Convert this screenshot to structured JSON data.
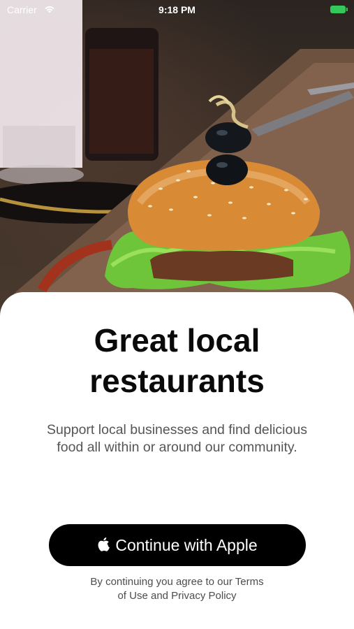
{
  "status_bar": {
    "carrier": "Carrier",
    "time": "9:18 PM",
    "battery_color": "#34c759"
  },
  "hero": {
    "image": "burger-photo",
    "description_icon": "burger-image"
  },
  "onboarding": {
    "title_line1": "Great local",
    "title_line2": "restaurants",
    "subtitle": "Support local businesses and find delicious food all within or around our community.",
    "apple_button_label": "Continue with Apple",
    "terms_line1": "By continuing you agree to our Terms",
    "terms_line2": "of Use and Privacy Policy"
  },
  "colors": {
    "button_bg": "#000000",
    "title": "#0a0a0a",
    "subtitle": "#555555"
  }
}
